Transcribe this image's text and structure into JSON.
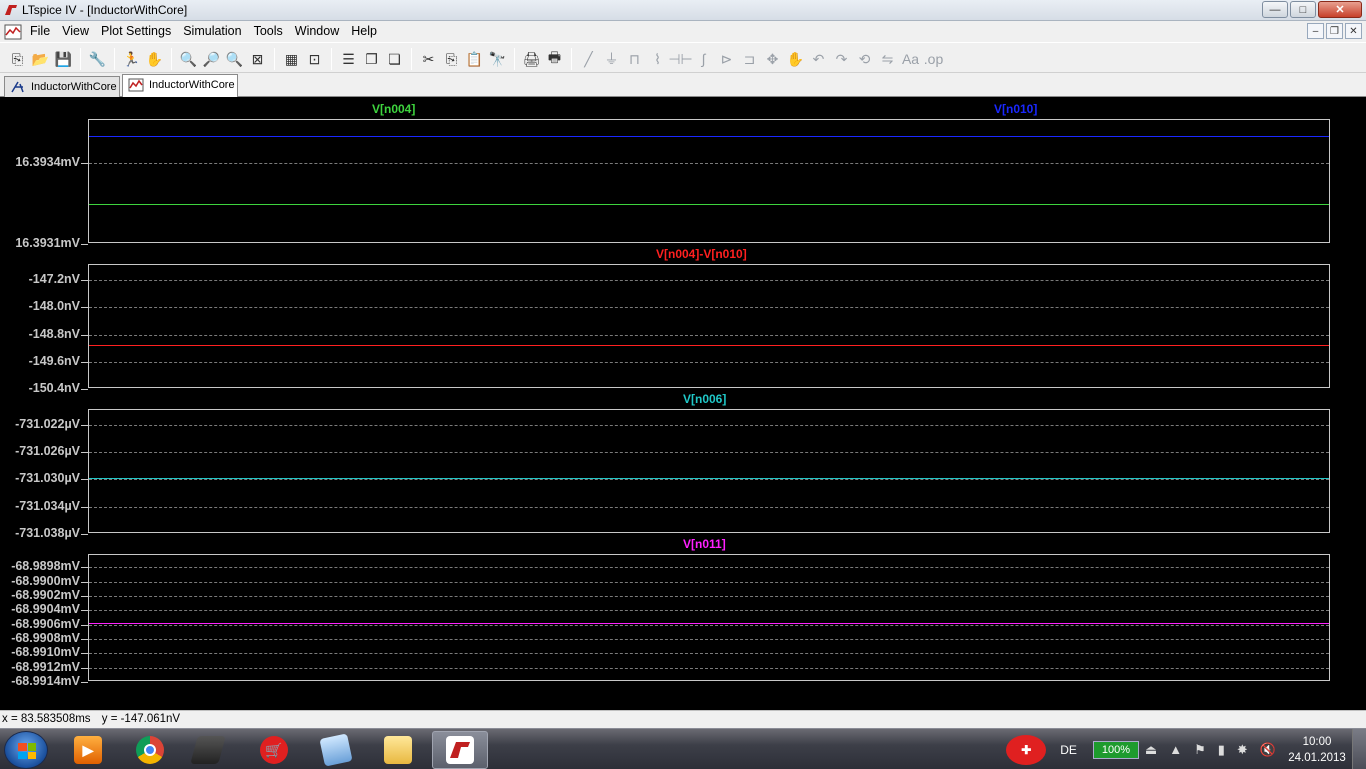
{
  "window": {
    "title": "LTspice IV - [InductorWithCore]",
    "controls": {
      "minimize": "—",
      "maximize": "□",
      "close": "✕"
    }
  },
  "menu": {
    "items": [
      {
        "label": "File"
      },
      {
        "label": "View"
      },
      {
        "label": "Plot Settings"
      },
      {
        "label": "Simulation"
      },
      {
        "label": "Tools"
      },
      {
        "label": "Window"
      },
      {
        "label": "Help"
      }
    ],
    "mdi_controls": {
      "minimize": "–",
      "restore": "❐",
      "close": "✕"
    }
  },
  "toolbar": {
    "buttons": [
      {
        "name": "new-schematic-icon",
        "glyph": "⎘"
      },
      {
        "name": "open-icon",
        "glyph": "📂"
      },
      {
        "name": "save-icon",
        "glyph": "💾"
      },
      {
        "name": "control-panel-icon",
        "glyph": "🔧"
      },
      {
        "name": "run-icon",
        "glyph": "🏃"
      },
      {
        "name": "halt-icon",
        "glyph": "✋"
      },
      {
        "name": "zoom-in-icon",
        "glyph": "🔍"
      },
      {
        "name": "zoom-pan-icon",
        "glyph": "🔎"
      },
      {
        "name": "zoom-out-icon",
        "glyph": "🔍"
      },
      {
        "name": "zoom-fit-icon",
        "glyph": "⊠"
      },
      {
        "name": "autorange-icon",
        "glyph": "▦"
      },
      {
        "name": "mark-unsel-icon",
        "glyph": "⊡"
      },
      {
        "name": "tile-horizontal-icon",
        "glyph": "☰"
      },
      {
        "name": "cascade-icon",
        "glyph": "❐"
      },
      {
        "name": "close-all-icon",
        "glyph": "❏"
      },
      {
        "name": "cut-icon",
        "glyph": "✂"
      },
      {
        "name": "copy-icon",
        "glyph": "⎘"
      },
      {
        "name": "paste-icon",
        "glyph": "📋"
      },
      {
        "name": "find-icon",
        "glyph": "🔭"
      },
      {
        "name": "print-preview-icon",
        "glyph": "🖨"
      },
      {
        "name": "print-icon",
        "glyph": "🖶"
      },
      {
        "name": "wire-icon",
        "glyph": "╱",
        "dim": true
      },
      {
        "name": "ground-icon",
        "glyph": "⏚",
        "dim": true
      },
      {
        "name": "label-net-icon",
        "glyph": "⊓",
        "dim": true
      },
      {
        "name": "resistor-icon",
        "glyph": "⌇",
        "dim": true
      },
      {
        "name": "capacitor-icon",
        "glyph": "⊣⊢",
        "dim": true
      },
      {
        "name": "inductor-icon",
        "glyph": "∫",
        "dim": true
      },
      {
        "name": "diode-icon",
        "glyph": "⊳",
        "dim": true
      },
      {
        "name": "component-icon",
        "glyph": "⊐",
        "dim": true
      },
      {
        "name": "move-icon",
        "glyph": "✥",
        "dim": true
      },
      {
        "name": "drag-icon",
        "glyph": "✋",
        "dim": true
      },
      {
        "name": "undo-icon",
        "glyph": "↶",
        "dim": true
      },
      {
        "name": "redo-icon",
        "glyph": "↷",
        "dim": true
      },
      {
        "name": "rotate-icon",
        "glyph": "⟲",
        "dim": true
      },
      {
        "name": "mirror-icon",
        "glyph": "⇋",
        "dim": true
      },
      {
        "name": "text-icon",
        "glyph": "Aa",
        "dim": true
      },
      {
        "name": "spice-directive-icon",
        "glyph": ".op",
        "dim": true
      }
    ]
  },
  "tabs": [
    {
      "label": "InductorWithCore",
      "kind": "schematic",
      "active": false
    },
    {
      "label": "InductorWithCore",
      "kind": "waveform",
      "active": true
    }
  ],
  "plot": {
    "colors": {
      "green": "#3ed43e",
      "blue": "#1a28ff",
      "red": "#ff2020",
      "cyan": "#20c8c8",
      "magenta": "#ff20ff",
      "axis": "#c8c8c8"
    },
    "panes": [
      {
        "traces": [
          {
            "label": "V[n004]",
            "color": "#3ed43e",
            "value": 16.39325
          },
          {
            "label": "V[n010]",
            "color": "#1a28ff",
            "value": 16.3935
          }
        ],
        "unit_suffix": "mV",
        "ticks": [
          "16.3934mV",
          "16.3931mV"
        ],
        "tick_values": [
          16.3934,
          16.3931
        ],
        "grid_values": [
          16.3934
        ],
        "range": [
          16.3931,
          16.39356
        ]
      },
      {
        "traces": [
          {
            "label": "V[n004]-V[n010]",
            "color": "#ff2020",
            "value": -149.1
          }
        ],
        "ticks": [
          "-147.2nV",
          "-148.0nV",
          "-148.8nV",
          "-149.6nV",
          "-150.4nV"
        ],
        "tick_values": [
          -147.2,
          -148.0,
          -148.8,
          -149.6,
          -150.4
        ],
        "grid_values": [
          -147.2,
          -148.0,
          -148.8,
          -149.6
        ],
        "range": [
          -150.4,
          -146.75
        ]
      },
      {
        "traces": [
          {
            "label": "V[n006]",
            "color": "#20c8c8",
            "value": -731.0298
          }
        ],
        "ticks": [
          "-731.022µV",
          "-731.026µV",
          "-731.030µV",
          "-731.034µV",
          "-731.038µV"
        ],
        "tick_values": [
          -731.022,
          -731.026,
          -731.03,
          -731.034,
          -731.038
        ],
        "grid_values": [
          -731.022,
          -731.026,
          -731.03,
          -731.034
        ],
        "range": [
          -731.038,
          -731.0198
        ]
      },
      {
        "traces": [
          {
            "label": "V[n011]",
            "color": "#ff20ff",
            "value": -68.99058
          }
        ],
        "ticks": [
          "-68.9898mV",
          "-68.9900mV",
          "-68.9902mV",
          "-68.9904mV",
          "-68.9906mV",
          "-68.9908mV",
          "-68.9910mV",
          "-68.9912mV",
          "-68.9914mV"
        ],
        "tick_values": [
          -68.9898,
          -68.99,
          -68.9902,
          -68.9904,
          -68.9906,
          -68.9908,
          -68.991,
          -68.9912,
          -68.9914
        ],
        "grid_values": [
          -68.9898,
          -68.99,
          -68.9902,
          -68.9904,
          -68.9906,
          -68.9908,
          -68.991,
          -68.9912
        ],
        "range": [
          -68.9914,
          -68.98963
        ]
      }
    ]
  },
  "status": {
    "x_readout": "x = 83.583508ms",
    "y_readout": "y = -147.061nV"
  },
  "taskbar": {
    "language": "DE",
    "battery": "100%",
    "time": "10:00",
    "date": "24.01.2013"
  }
}
